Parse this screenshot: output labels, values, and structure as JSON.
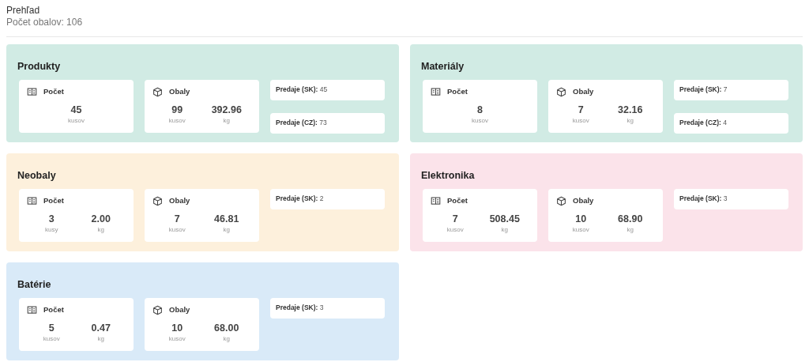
{
  "header": {
    "title": "Prehľad",
    "subtitle": "Počet obalov: 106"
  },
  "sections": [
    {
      "title": "Produkty",
      "color": "#d1ebe4",
      "stats": [
        {
          "kind": "count",
          "title": "Počet",
          "values": [
            {
              "value": "45",
              "unit": "kusov"
            }
          ]
        },
        {
          "kind": "packaging",
          "title": "Obaly",
          "values": [
            {
              "value": "99",
              "unit": "kusov"
            },
            {
              "value": "392.96",
              "unit": "kg"
            }
          ]
        }
      ],
      "sales": [
        "**Predaje (SK):** 45",
        "**Predaje (CZ):** 73"
      ]
    },
    {
      "title": "Materiály",
      "color": "#d1ebe4",
      "stats": [
        {
          "kind": "count",
          "title": "Počet",
          "values": [
            {
              "value": "8",
              "unit": "kusov"
            }
          ]
        },
        {
          "kind": "packaging",
          "title": "Obaly",
          "values": [
            {
              "value": "7",
              "unit": "kusov"
            },
            {
              "value": "32.16",
              "unit": "kg"
            }
          ]
        }
      ],
      "sales": [
        "**Predaje (SK):** 7",
        "**Predaje (CZ):** 4"
      ]
    },
    {
      "title": "Neobaly",
      "color": "#fdf0dc",
      "stats": [
        {
          "kind": "count",
          "title": "Počet",
          "values": [
            {
              "value": "3",
              "unit": "kusy"
            },
            {
              "value": "2.00",
              "unit": "kg"
            }
          ]
        },
        {
          "kind": "packaging",
          "title": "Obaly",
          "values": [
            {
              "value": "7",
              "unit": "kusov"
            },
            {
              "value": "46.81",
              "unit": "kg"
            }
          ]
        }
      ],
      "sales": [
        "**Predaje (SK):** 2"
      ]
    },
    {
      "title": "Elektronika",
      "color": "#fbe3ea",
      "stats": [
        {
          "kind": "count",
          "title": "Počet",
          "values": [
            {
              "value": "7",
              "unit": "kusov"
            },
            {
              "value": "508.45",
              "unit": "kg"
            }
          ]
        },
        {
          "kind": "packaging",
          "title": "Obaly",
          "values": [
            {
              "value": "10",
              "unit": "kusov"
            },
            {
              "value": "68.90",
              "unit": "kg"
            }
          ]
        }
      ],
      "sales": [
        "**Predaje (SK):** 3"
      ]
    },
    {
      "title": "Batérie",
      "color": "#d9eaf8",
      "stats": [
        {
          "kind": "count",
          "title": "Počet",
          "values": [
            {
              "value": "5",
              "unit": "kusov"
            },
            {
              "value": "0.47",
              "unit": "kg"
            }
          ]
        },
        {
          "kind": "packaging",
          "title": "Obaly",
          "values": [
            {
              "value": "10",
              "unit": "kusov"
            },
            {
              "value": "68.00",
              "unit": "kg"
            }
          ]
        }
      ],
      "sales": [
        "**Predaje (SK):** 3"
      ]
    }
  ]
}
